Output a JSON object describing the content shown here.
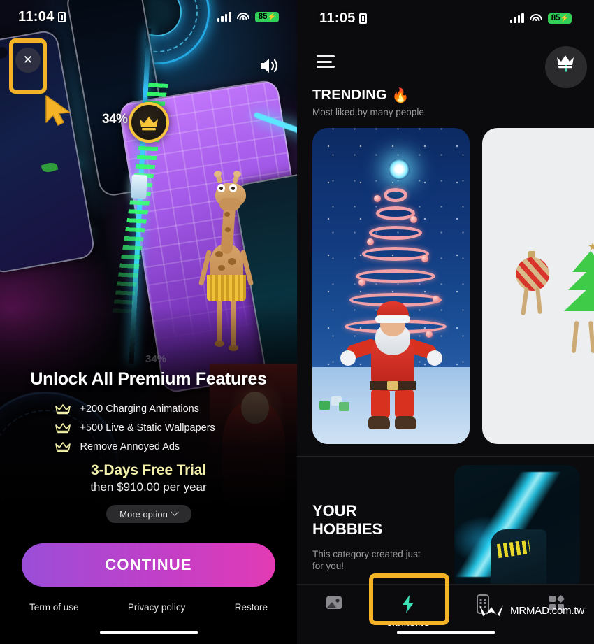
{
  "left_screen": {
    "status_bar": {
      "time": "11:04",
      "battery": "85",
      "battery_bolt": "⚡",
      "lock_icon": "lock-icon"
    },
    "close_button": {
      "icon": "✕",
      "name": "close-icon"
    },
    "speaker_button": {
      "name": "speaker-icon"
    },
    "charging_overlay": {
      "percent_main": "34%",
      "percent_faint": "34%"
    },
    "paywall": {
      "crown_badge": "crown-icon",
      "title": "Unlock All Premium Features",
      "features": [
        {
          "icon": "crown-icon",
          "label": "+200 Charging Animations"
        },
        {
          "icon": "crown-icon",
          "label": "+500 Live & Static Wallpapers"
        },
        {
          "icon": "crown-icon",
          "label": "Remove Annoyed Ads"
        }
      ],
      "trial_text": "3-Days Free Trial",
      "price_text": "then $910.00 per year",
      "more_option_label": "More option",
      "continue_label": "CONTINUE",
      "links": [
        "Term of use",
        "Privacy policy",
        "Restore"
      ]
    },
    "highlight_color": "#f4b327"
  },
  "right_screen": {
    "status_bar": {
      "time": "11:05",
      "battery": "85",
      "battery_bolt": "⚡"
    },
    "header": {
      "menu_icon": "hamburger-menu-icon",
      "premium_icon": "crown-icon"
    },
    "trending": {
      "title": "TRENDING",
      "title_emoji": "🔥",
      "subtitle": "Most liked by many people",
      "cards": [
        {
          "name": "christmas-santa-wallpaper"
        },
        {
          "name": "christmas-ornaments-wallpaper"
        }
      ]
    },
    "hobbies": {
      "title_line1": "YOUR",
      "title_line2": "HOBBIES",
      "subtitle": "This category created just for you!",
      "add_button": "+"
    },
    "tabbar": [
      {
        "name": "tab-wallpapers",
        "icon": "image-icon",
        "label": ""
      },
      {
        "name": "tab-charging",
        "icon": "bolt-icon",
        "label": "CHARGING",
        "active": true
      },
      {
        "name": "tab-widgets",
        "icon": "phone-icon",
        "label": ""
      },
      {
        "name": "tab-apps",
        "icon": "grid-icon",
        "label": ""
      }
    ],
    "watermark": {
      "brand": "MRMAD",
      "suffix": ".com.tw"
    },
    "accent_color": "#3ee0b5",
    "highlight_color": "#f4b327"
  }
}
